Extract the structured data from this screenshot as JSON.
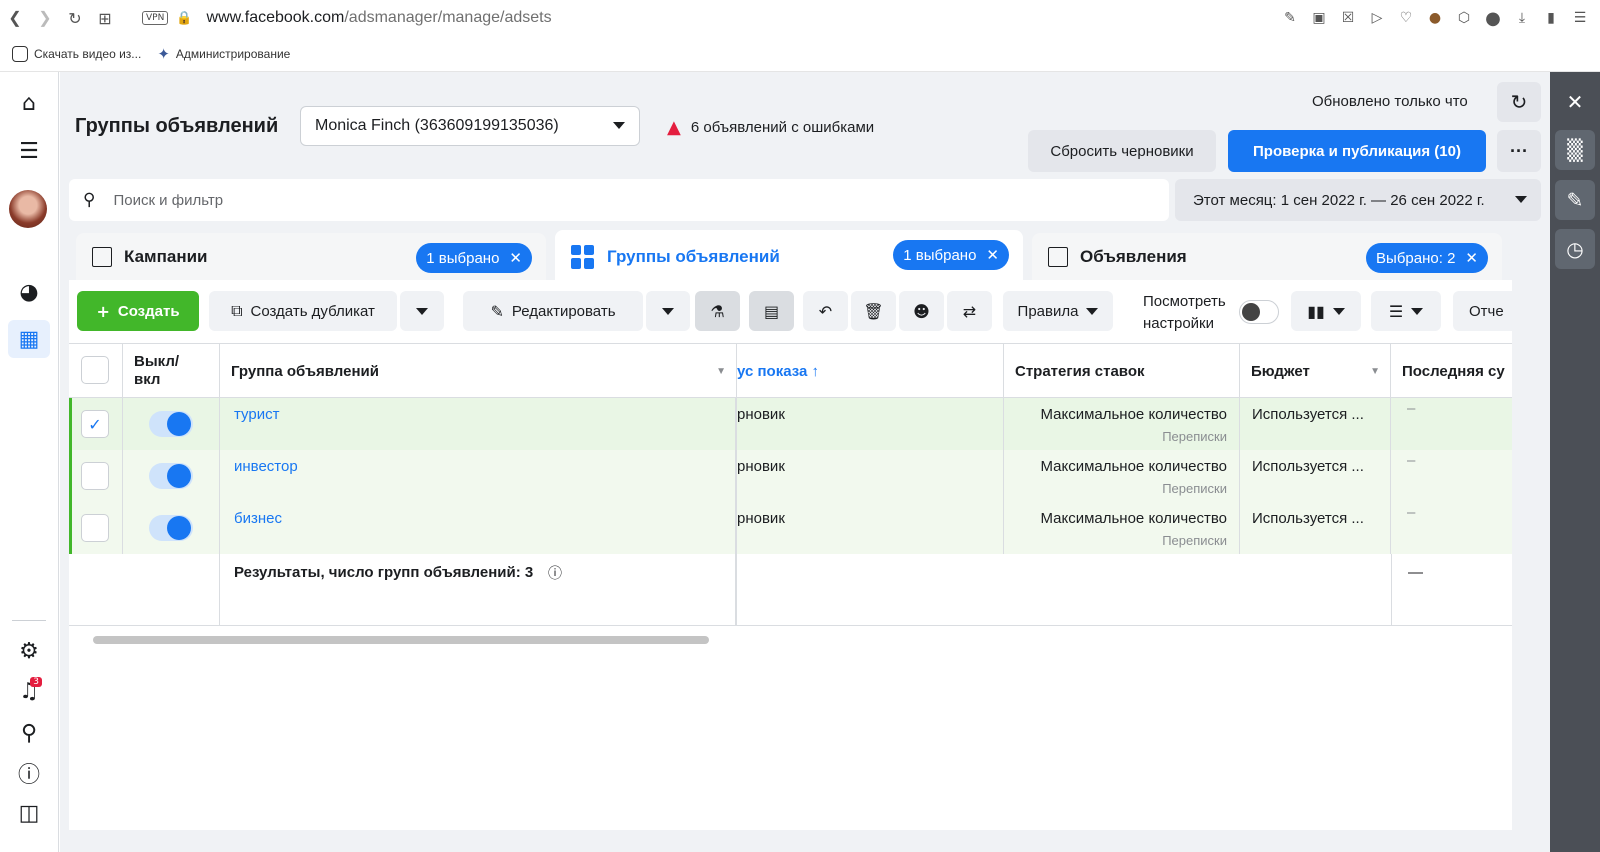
{
  "browser": {
    "url_host": "www.facebook.com",
    "url_path": "/adsmanager/manage/adsets",
    "vpn_label": "VPN",
    "bookmarks": [
      "Скачать видео из...",
      "Администрирование"
    ]
  },
  "header": {
    "title": "Группы объявлений",
    "account": "Monica Finch (363609199135036)",
    "errors": "6 объявлений с ошибками",
    "updated": "Обновлено только что",
    "reset_label": "Сбросить черновики",
    "publish_label": "Проверка и публикация (10)",
    "more_label": "···"
  },
  "search": {
    "placeholder": "Поиск и фильтр",
    "date_range": "Этот месяц: 1 сен 2022 г. — 26 сен 2022 г."
  },
  "tabs": [
    {
      "label": "Кампании",
      "selected": "1 выбрано"
    },
    {
      "label": "Группы объявлений",
      "selected": "1 выбрано"
    },
    {
      "label": "Объявления",
      "selected": "Выбрано: 2"
    }
  ],
  "toolbar": {
    "create": "Создать",
    "duplicate": "Создать дубликат",
    "edit": "Редактировать",
    "rules": "Правила",
    "view_settings_1": "Посмотреть",
    "view_settings_2": "настройки",
    "reports": "Отче"
  },
  "table": {
    "columns": {
      "toggle_1": "Выкл/",
      "toggle_2": "вкл",
      "name": "Группа объявлений",
      "status": "ус показа ↑",
      "strategy": "Стратегия ставок",
      "budget": "Бюджет",
      "last": "Последняя су"
    },
    "rows": [
      {
        "name": "турист",
        "status": "рновик",
        "strategy": "Максимальное количество",
        "strategy_sub": "Переписки",
        "budget": "Используется ...",
        "last": "–",
        "checked": true
      },
      {
        "name": "инвестор",
        "status": "рновик",
        "strategy": "Максимальное количество",
        "strategy_sub": "Переписки",
        "budget": "Используется ...",
        "last": "–",
        "checked": false
      },
      {
        "name": "бизнес",
        "status": "рновик",
        "strategy": "Максимальное количество",
        "strategy_sub": "Переписки",
        "budget": "Используется ...",
        "last": "–",
        "checked": false
      }
    ],
    "summary": "Результаты, число групп объявлений: 3",
    "summary_last": "—"
  },
  "colors": {
    "accent": "#1877f2",
    "create": "#42b72a",
    "error": "#e41e3f",
    "row_selected": "#e9f6e5"
  },
  "notifications_badge": "3"
}
